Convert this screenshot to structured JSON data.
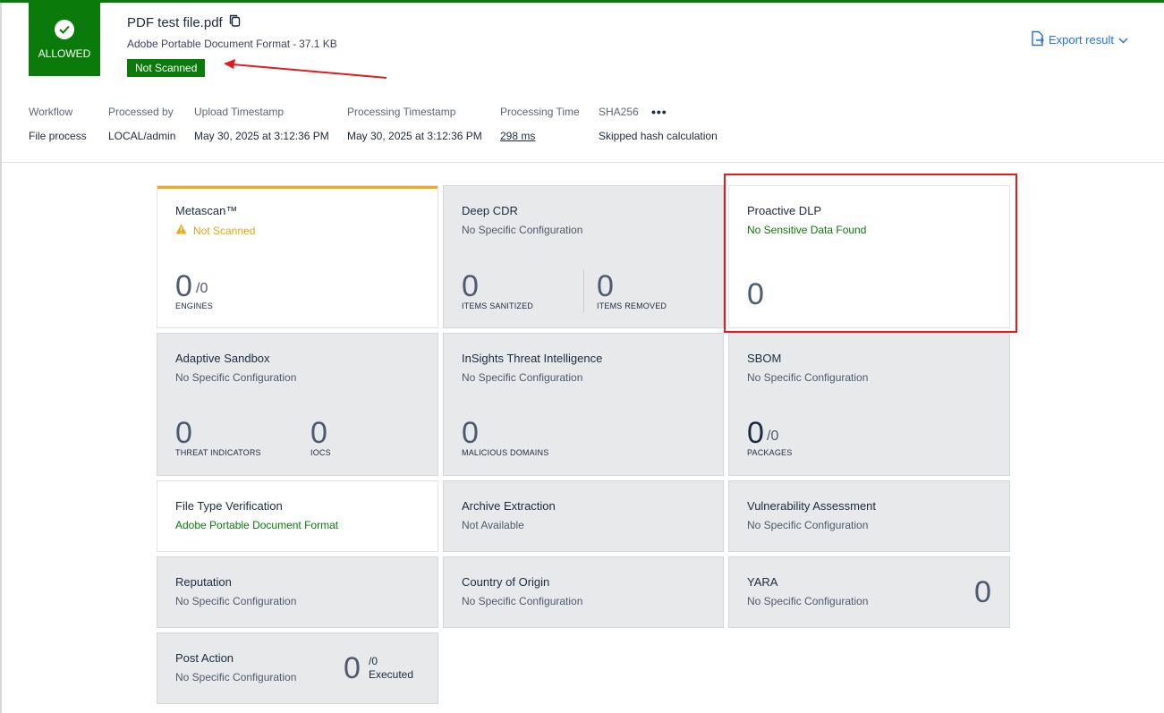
{
  "header": {
    "verdict": "ALLOWED",
    "filename": "PDF test file.pdf",
    "filetype": "Adobe Portable Document Format",
    "filesize": "37.1 KB",
    "scan_status": "Not Scanned",
    "export_label": "Export result",
    "brand_color": "#0a7a0a",
    "accent_color": "#2672c9"
  },
  "meta": {
    "workflow_key": "Workflow",
    "workflow_val": "File process",
    "processed_key": "Processed by",
    "processed_val": "LOCAL/admin",
    "upload_key": "Upload Timestamp",
    "upload_val": "May 30, 2025 at 3:12:36 PM",
    "processing_ts_key": "Processing Timestamp",
    "processing_ts_val": "May 30, 2025 at 3:12:36 PM",
    "processing_time_key": "Processing Time",
    "processing_time_val": "298 ms",
    "sha_key": "SHA256",
    "sha_val": "Skipped hash calculation",
    "more": "•••"
  },
  "cards": {
    "metascan": {
      "title": "Metascan™",
      "status": "Not Scanned",
      "count": "0",
      "den": "/0",
      "label": "ENGINES"
    },
    "deepcdr": {
      "title": "Deep CDR",
      "status": "No Specific Configuration",
      "a": "0",
      "a_label": "ITEMS SANITIZED",
      "b": "0",
      "b_label": "ITEMS REMOVED"
    },
    "dlp": {
      "title": "Proactive DLP",
      "status": "No Sensitive Data Found",
      "count": "0"
    },
    "sandbox": {
      "title": "Adaptive Sandbox",
      "status": "No Specific Configuration",
      "a": "0",
      "a_label": "THREAT INDICATORS",
      "b": "0",
      "b_label": "IOCS"
    },
    "insights": {
      "title": "InSights Threat Intelligence",
      "status": "No Specific Configuration",
      "count": "0",
      "label": "MALICIOUS DOMAINS"
    },
    "sbom": {
      "title": "SBOM",
      "status": "No Specific Configuration",
      "count": "0",
      "den": "/0",
      "label": "PACKAGES"
    },
    "filetype": {
      "title": "File Type Verification",
      "status": "Adobe Portable Document Format"
    },
    "archive": {
      "title": "Archive Extraction",
      "status": "Not Available"
    },
    "vuln": {
      "title": "Vulnerability Assessment",
      "status": "No Specific Configuration"
    },
    "reputation": {
      "title": "Reputation",
      "status": "No Specific Configuration"
    },
    "origin": {
      "title": "Country of Origin",
      "status": "No Specific Configuration"
    },
    "yara": {
      "title": "YARA",
      "status": "No Specific Configuration",
      "count": "0"
    },
    "postaction": {
      "title": "Post Action",
      "status": "No Specific Configuration",
      "count": "0",
      "den": "/0",
      "label": "Executed"
    }
  }
}
